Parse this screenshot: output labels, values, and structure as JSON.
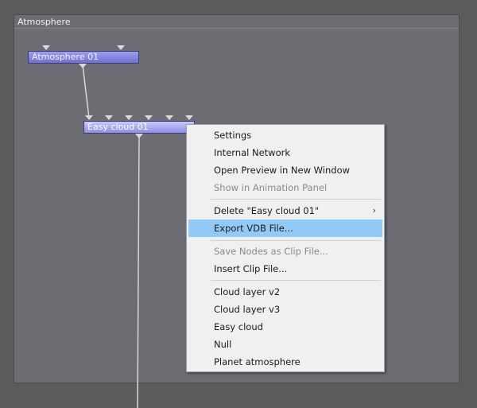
{
  "panel": {
    "title": "Atmosphere"
  },
  "nodes": {
    "atmosphere": {
      "label": "Atmosphere 01"
    },
    "cloud": {
      "label": "Easy cloud 01"
    }
  },
  "menu": {
    "settings": "Settings",
    "internal_network": "Internal Network",
    "open_preview": "Open Preview in New Window",
    "show_anim": "Show in Animation Panel",
    "delete": "Delete \"Easy cloud 01\"",
    "export_vdb": "Export VDB File...",
    "save_clip": "Save Nodes as Clip File...",
    "insert_clip": "Insert Clip File...",
    "cloud_v2": "Cloud layer v2",
    "cloud_v3": "Cloud layer v3",
    "easy_cloud": "Easy cloud",
    "null": "Null",
    "planet_atm": "Planet atmosphere"
  },
  "colors": {
    "highlight": "#91c9f7",
    "node_blue": "#7a7ae0"
  }
}
